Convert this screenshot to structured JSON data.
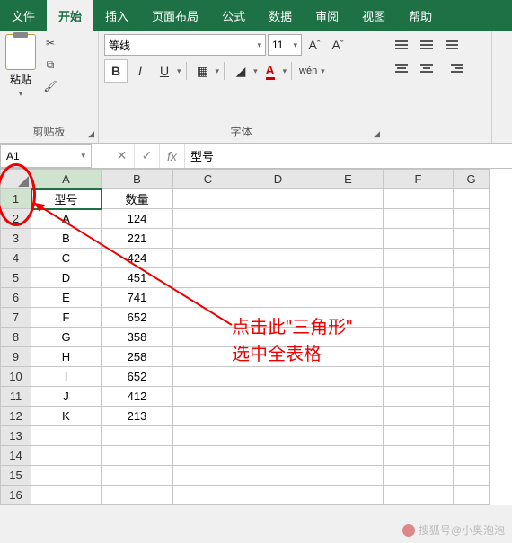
{
  "tabs": {
    "file": "文件",
    "home": "开始",
    "insert": "插入",
    "layout": "页面布局",
    "formula": "公式",
    "data": "数据",
    "review": "审阅",
    "view": "视图",
    "help": "帮助"
  },
  "ribbon": {
    "clipboard": {
      "paste": "粘贴",
      "label": "剪贴板"
    },
    "font": {
      "name": "等线",
      "size": "11",
      "bold": "B",
      "italic": "I",
      "underline": "U",
      "wen": "wén",
      "label": "字体",
      "grow": "A",
      "shrink": "A"
    },
    "align": {}
  },
  "fbar": {
    "cell_ref": "A1",
    "fx": "fx",
    "value": "型号"
  },
  "columns": [
    "A",
    "B",
    "C",
    "D",
    "E",
    "F",
    "G"
  ],
  "col_widths": [
    "colA",
    "colB",
    "colC",
    "colD",
    "colE",
    "colF",
    "colG"
  ],
  "row_count": 16,
  "headers": {
    "A": "型号",
    "B": "数量"
  },
  "rows": [
    {
      "A": "A",
      "B": "124"
    },
    {
      "A": "B",
      "B": "221"
    },
    {
      "A": "C",
      "B": "424"
    },
    {
      "A": "D",
      "B": "451"
    },
    {
      "A": "E",
      "B": "741"
    },
    {
      "A": "F",
      "B": "652"
    },
    {
      "A": "G",
      "B": "358"
    },
    {
      "A": "H",
      "B": "258"
    },
    {
      "A": "I",
      "B": "652"
    },
    {
      "A": "J",
      "B": "412"
    },
    {
      "A": "K",
      "B": "213"
    }
  ],
  "annotation": {
    "line1": "点击此\"三角形\"",
    "line2": "选中全表格"
  },
  "watermark": {
    "text": "搜狐号@小奥泡泡"
  }
}
